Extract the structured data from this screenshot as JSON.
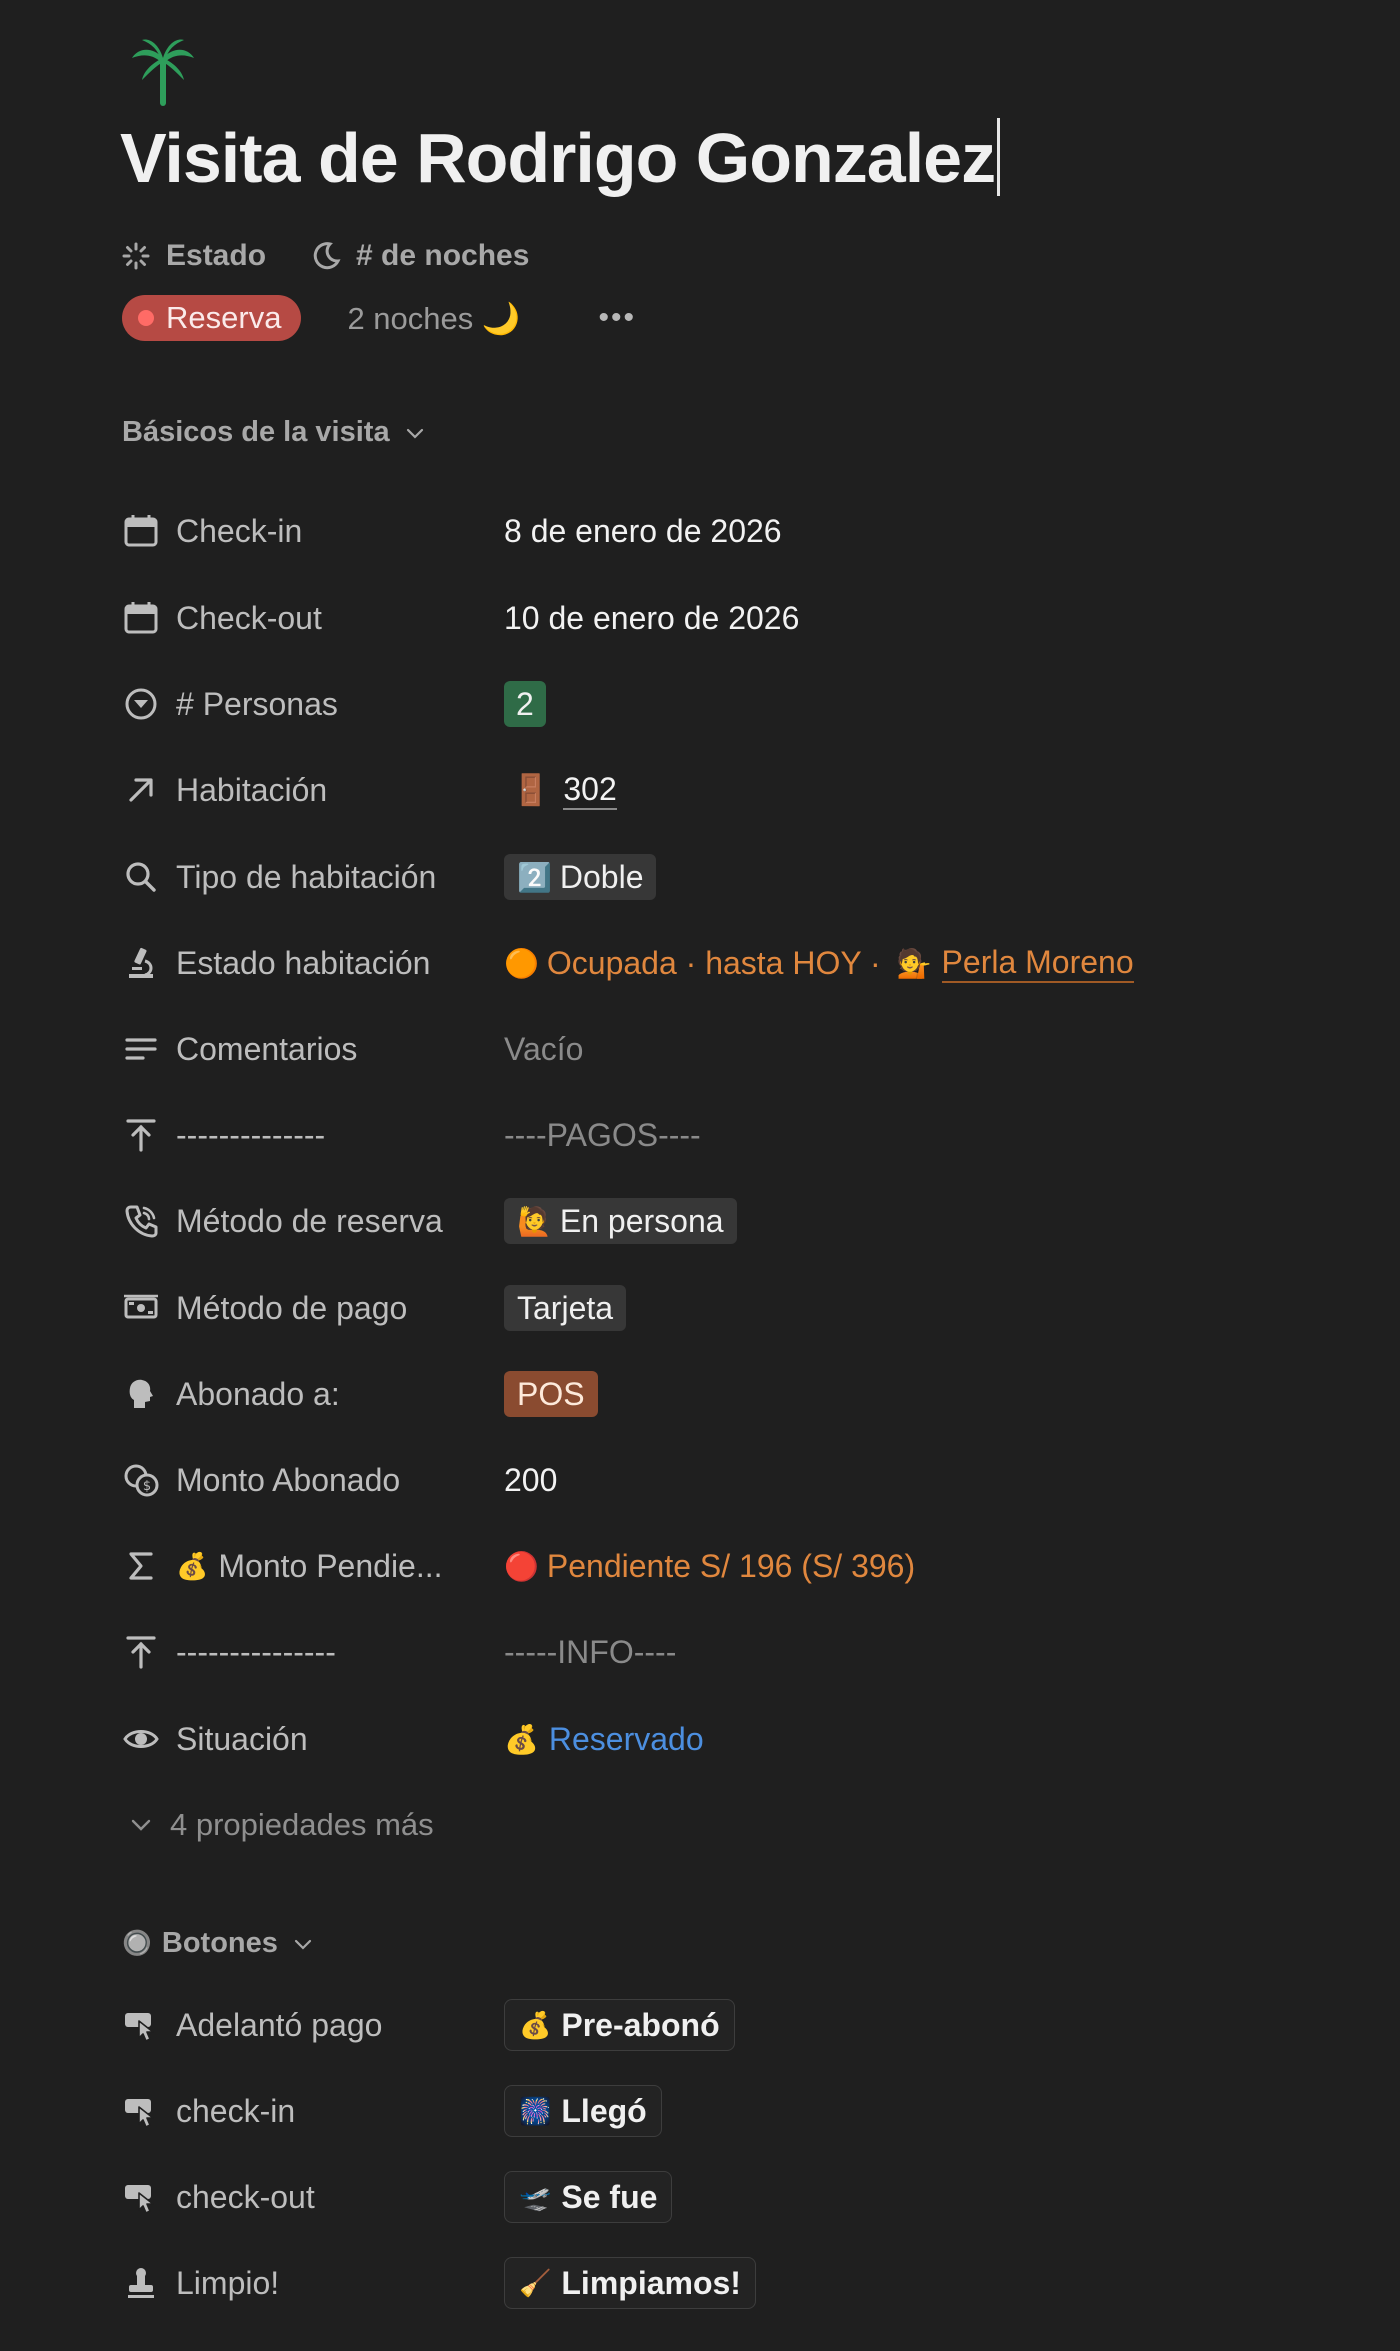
{
  "page": {
    "icon": "palm-tree-icon",
    "title": "Visita de Rodrigo Gonzalez"
  },
  "top_properties": {
    "estado_label": "Estado",
    "noches_label": "# de noches",
    "estado_value": "Reserva",
    "noches_value": "2 noches 🌙",
    "more": "•••"
  },
  "section_basics": {
    "label": "Básicos de la visita",
    "rows": [
      {
        "icon": "calendar-icon",
        "name": "Check-in",
        "value": "8 de enero de 2026"
      },
      {
        "icon": "calendar-icon",
        "name": "Check-out",
        "value": "10 de enero de 2026"
      },
      {
        "icon": "select-circle-icon",
        "name": "# Personas",
        "value": "2"
      },
      {
        "icon": "relation-arrow-icon",
        "name": "Habitación",
        "emoji": "🚪",
        "value": "302"
      },
      {
        "icon": "search-icon",
        "name": "Tipo de habitación",
        "emoji": "2️⃣",
        "value": "Doble"
      },
      {
        "icon": "microscope-icon",
        "name": "Estado habitación",
        "emoji": "🟠",
        "value": "Ocupada · hasta HOY ·",
        "emoji2": "💁",
        "person": "Perla Moreno"
      },
      {
        "icon": "text-lines-icon",
        "name": "Comentarios",
        "value": "Vacío"
      },
      {
        "icon": "upload-arrow-icon",
        "name": "--------------",
        "value": "----PAGOS----"
      },
      {
        "icon": "phone-icon",
        "name": "Método de reserva",
        "emoji": "🙋",
        "value": "En persona"
      },
      {
        "icon": "money-icon",
        "name": "Método de pago",
        "value": "Tarjeta"
      },
      {
        "icon": "person-bust-icon",
        "name": "Abonado a:",
        "value": "POS"
      },
      {
        "icon": "coins-icon",
        "name": "Monto Abonado",
        "value": "200"
      },
      {
        "icon": "sigma-icon",
        "name_emoji": "💰",
        "name": "Monto Pendie...",
        "emoji": "🔴",
        "value": "Pendiente S/ 196 (S/ 396)"
      },
      {
        "icon": "upload-arrow-icon",
        "name": "---------------",
        "value": "-----INFO----"
      },
      {
        "icon": "eye-icon",
        "name": "Situación",
        "emoji": "💰",
        "value": "Reservado"
      }
    ],
    "more_props": "4 propiedades más"
  },
  "section_buttons": {
    "label": "Botones",
    "label_emoji": "🔘",
    "rows": [
      {
        "icon": "click-hand-icon",
        "name": "Adelantó pago",
        "emoji": "💰",
        "button": "Pre-abonó"
      },
      {
        "icon": "click-hand-icon",
        "name": "check-in",
        "emoji": "🎆",
        "button": "Llegó"
      },
      {
        "icon": "click-hand-icon",
        "name": "check-out",
        "emoji": "🛫",
        "button": "Se fue"
      },
      {
        "icon": "stamp-icon",
        "name": "Limpio!",
        "emoji": "🧹",
        "button": "Limpiamos!"
      }
    ]
  },
  "colors": {
    "background": "#1f1f1f",
    "estado_pill": "#b64a44",
    "personas_chip": "#2f6b47",
    "pos_chip": "#8a4b30",
    "orange_text": "#e0873e",
    "blue_text": "#4c8fe0"
  }
}
